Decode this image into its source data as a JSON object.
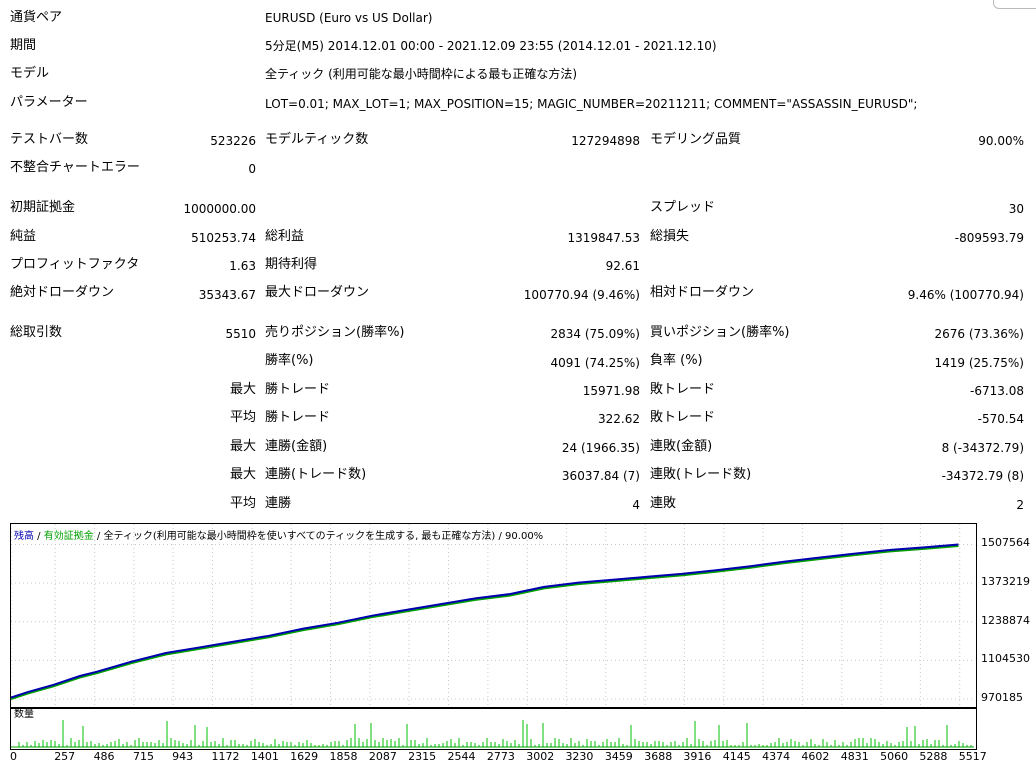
{
  "params": {
    "pair_label": "通貨ペア",
    "pair_value": "EURUSD (Euro vs US Dollar)",
    "period_label": "期間",
    "period_value": "5分足(M5) 2014.12.01 00:00 - 2021.12.09 23:55 (2014.12.01 - 2021.12.10)",
    "model_label": "モデル",
    "model_value": "全ティック (利用可能な最小時間枠による最も正確な方法)",
    "param_label": "パラメーター",
    "param_value": "LOT=0.01; MAX_LOT=1; MAX_POSITION=15; MAGIC_NUMBER=20211211; COMMENT=\"ASSASSIN_EURUSD\";"
  },
  "stats": {
    "bars_label": "テストバー数",
    "bars_value": "523226",
    "ticks_label": "モデルティック数",
    "ticks_value": "127294898",
    "quality_label": "モデリング品質",
    "quality_value": "90.00%",
    "mismatch_label": "不整合チャートエラー",
    "mismatch_value": "0",
    "deposit_label": "初期証拠金",
    "deposit_value": "1000000.00",
    "spread_label": "スプレッド",
    "spread_value": "30",
    "net_label": "純益",
    "net_value": "510253.74",
    "gross_profit_label": "総利益",
    "gross_profit_value": "1319847.53",
    "gross_loss_label": "総損失",
    "gross_loss_value": "-809593.79",
    "pf_label": "プロフィットファクタ",
    "pf_value": "1.63",
    "payoff_label": "期待利得",
    "payoff_value": "92.61",
    "abs_dd_label": "絶対ドローダウン",
    "abs_dd_value": "35343.67",
    "max_dd_label": "最大ドローダウン",
    "max_dd_value": "100770.94 (9.46%)",
    "rel_dd_label": "相対ドローダウン",
    "rel_dd_value": "9.46% (100770.94)",
    "trades_label": "総取引数",
    "trades_value": "5510",
    "short_label": "売りポジション(勝率%)",
    "short_value": "2834 (75.09%)",
    "long_label": "買いポジション(勝率%)",
    "long_value": "2676 (73.36%)",
    "win_label": "勝率(%)",
    "win_value": "4091 (74.25%)",
    "loss_label": "負率 (%)",
    "loss_value": "1419 (25.75%)",
    "max1": "最大",
    "lwin_label": "勝トレード",
    "lwin_value": "15971.98",
    "lloss_label": "敗トレード",
    "lloss_value": "-6713.08",
    "avg1": "平均",
    "awin_label": "勝トレード",
    "awin_value": "322.62",
    "aloss_label": "敗トレード",
    "aloss_value": "-570.54",
    "max2": "最大",
    "cwin_label": "連勝(金額)",
    "cwin_value": "24 (1966.35)",
    "closs_label": "連敗(金額)",
    "closs_value": "8 (-34372.79)",
    "max3": "最大",
    "cwin2_label": "連勝(トレード数)",
    "cwin2_value": "36037.84 (7)",
    "closs2_label": "連敗(トレード数)",
    "closs2_value": "-34372.79 (8)",
    "avg2": "平均",
    "awins_label": "連勝",
    "awins_value": "4",
    "alosses_label": "連敗",
    "alosses_value": "2"
  },
  "chart_title": {
    "balance": "残高",
    "sep1": " / ",
    "equity": "有効証拠金",
    "sep2": " / ",
    "rest": "全ティック(利用可能な最小時間枠を使いすべてのティックを生成する, 最も正確な方法) / 90.00%"
  },
  "volume_label": "数量",
  "colors": {
    "balance": "#0000b0",
    "equity": "#00a000",
    "volume": "#00c000"
  },
  "chart_data": {
    "type": "line",
    "yticks": [
      "1507564",
      "1373219",
      "1238874",
      "1104530",
      "970185"
    ],
    "xticks": [
      "0",
      "257",
      "486",
      "715",
      "943",
      "1172",
      "1401",
      "1629",
      "1858",
      "2087",
      "2315",
      "2544",
      "2773",
      "3002",
      "3230",
      "3459",
      "3688",
      "3916",
      "4145",
      "4374",
      "4602",
      "4831",
      "5060",
      "5288",
      "5517"
    ],
    "ylim": [
      970185,
      1530000
    ],
    "xlim": [
      0,
      5600
    ],
    "series": [
      {
        "x": [
          0,
          100,
          250,
          400,
          500,
          700,
          900,
          1100,
          1300,
          1500,
          1700,
          1900,
          2100,
          2300,
          2500,
          2700,
          2900,
          3100,
          3300,
          3500,
          3700,
          3900,
          4100,
          4300,
          4500,
          4700,
          4900,
          5100,
          5300,
          5510
        ],
        "y": [
          975000,
          995000,
          1020000,
          1050000,
          1065000,
          1100000,
          1130000,
          1150000,
          1170000,
          1190000,
          1215000,
          1235000,
          1260000,
          1280000,
          1300000,
          1320000,
          1335000,
          1360000,
          1375000,
          1385000,
          1395000,
          1405000,
          1418000,
          1432000,
          1448000,
          1462000,
          1475000,
          1488000,
          1497000,
          1507564
        ]
      }
    ]
  }
}
